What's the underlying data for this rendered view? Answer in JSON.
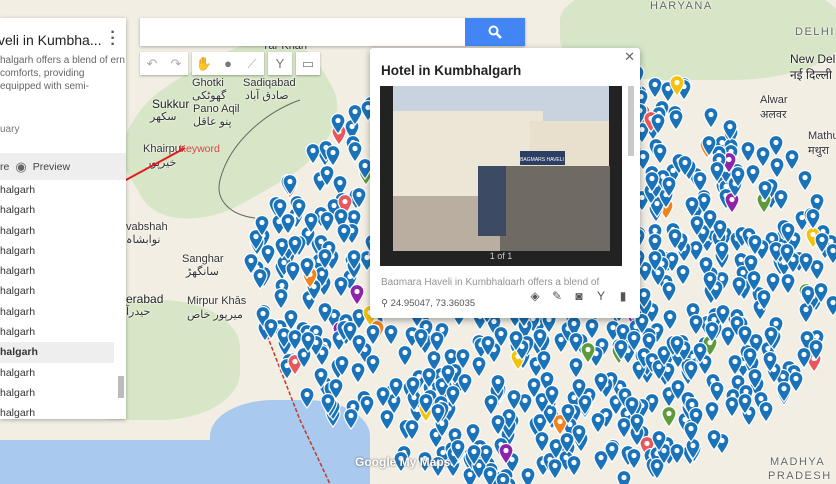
{
  "map": {
    "labels": {
      "haryana": "HARYANA",
      "delhi": "DELHI",
      "new_delhi": "New Delhi",
      "new_delhi_hi": "नई दिल्ली",
      "alwar": "Alwar",
      "alwar_hi": "अलवर",
      "mathura": "Mathura",
      "mathura_hi": "मथुरा",
      "madhya": "MADHYA",
      "pradesh": "PRADESH",
      "yar_khan": "Yar Khan",
      "ghotki": "Ghotki",
      "ghotki_ur": "گھوٹکی",
      "sadiqabad": "Sadiqabad",
      "sadiqabad_ur": "صادق آباد",
      "sukkur": "Sukkur",
      "sukkur_ur": "سکھر",
      "pano_aqil": "Pano Aqil",
      "pano_aqil_ur": "پنو عاقل",
      "khairpur": "Khairpur",
      "khairpur_ur": "خیرپور",
      "nawabshah": "vabshah",
      "nawabshah_ur": "نوابشاہ",
      "sanghar": "Sanghar",
      "sanghar_ur": "سانگھڑ",
      "hyderabad": "erabad",
      "hyderabad_ur": "حیدرآ",
      "mirpur": "Mirpur Khās",
      "mirpur_ur": "میرپور خاص"
    },
    "keyword_label": "Keyword",
    "watermark": "Google My Maps",
    "pin_colors": {
      "blue": "#1a73b8",
      "orange": "#f0831e",
      "red": "#e8575a",
      "green": "#5d9a3b",
      "purple": "#8e24aa",
      "yellow": "#f4c20d"
    }
  },
  "sidebar": {
    "title": "veli in Kumbha...",
    "description": "halgarh offers a blend of ern comforts, providing equipped with semi-",
    "date": "uary",
    "share_label": "re",
    "preview_label": "Preview",
    "rows": [
      "halgarh",
      "halgarh",
      "halgarh",
      "halgarh",
      "halgarh",
      "halgarh",
      "halgarh",
      "halgarh",
      "halgarh",
      "halgarh",
      "halgarh",
      "halgarh"
    ],
    "selected_index": 8
  },
  "search": {
    "value": "",
    "placeholder": ""
  },
  "popup": {
    "title": "Hotel in Kumbhalgarh",
    "photo_counter": "1 of 1",
    "description": "Bagmara Haveli in Kumbhalgarh offers a blend of",
    "coordinates": "24.95047, 73.36035",
    "hotel_sign": "BAGMARS HAVELI"
  }
}
